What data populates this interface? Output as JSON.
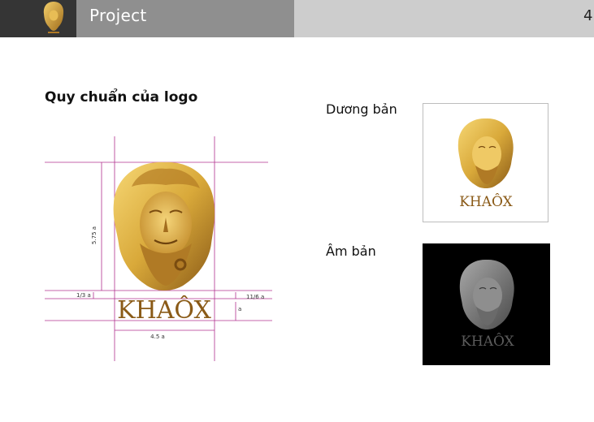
{
  "header": {
    "title": "Project",
    "page_number": "4"
  },
  "section": {
    "title": "Quy chuẩn của logo"
  },
  "logo": {
    "wordmark": "KHAÔX"
  },
  "construction": {
    "height_label": "5.75 a",
    "left_margin_label": "1/3 a",
    "right_margin_label": "11/6 a",
    "text_height_label": "a",
    "width_label": "4.5 a"
  },
  "variants": {
    "positive_label": "Dương bản",
    "negative_label": "Âm bản"
  },
  "colors": {
    "gold": "#d9a93a",
    "gold_dark": "#8a5a17",
    "guide_line": "#b0308f",
    "header_dark": "#353535",
    "header_mid": "#8f8f8f",
    "header_light": "#cdcdcd"
  }
}
